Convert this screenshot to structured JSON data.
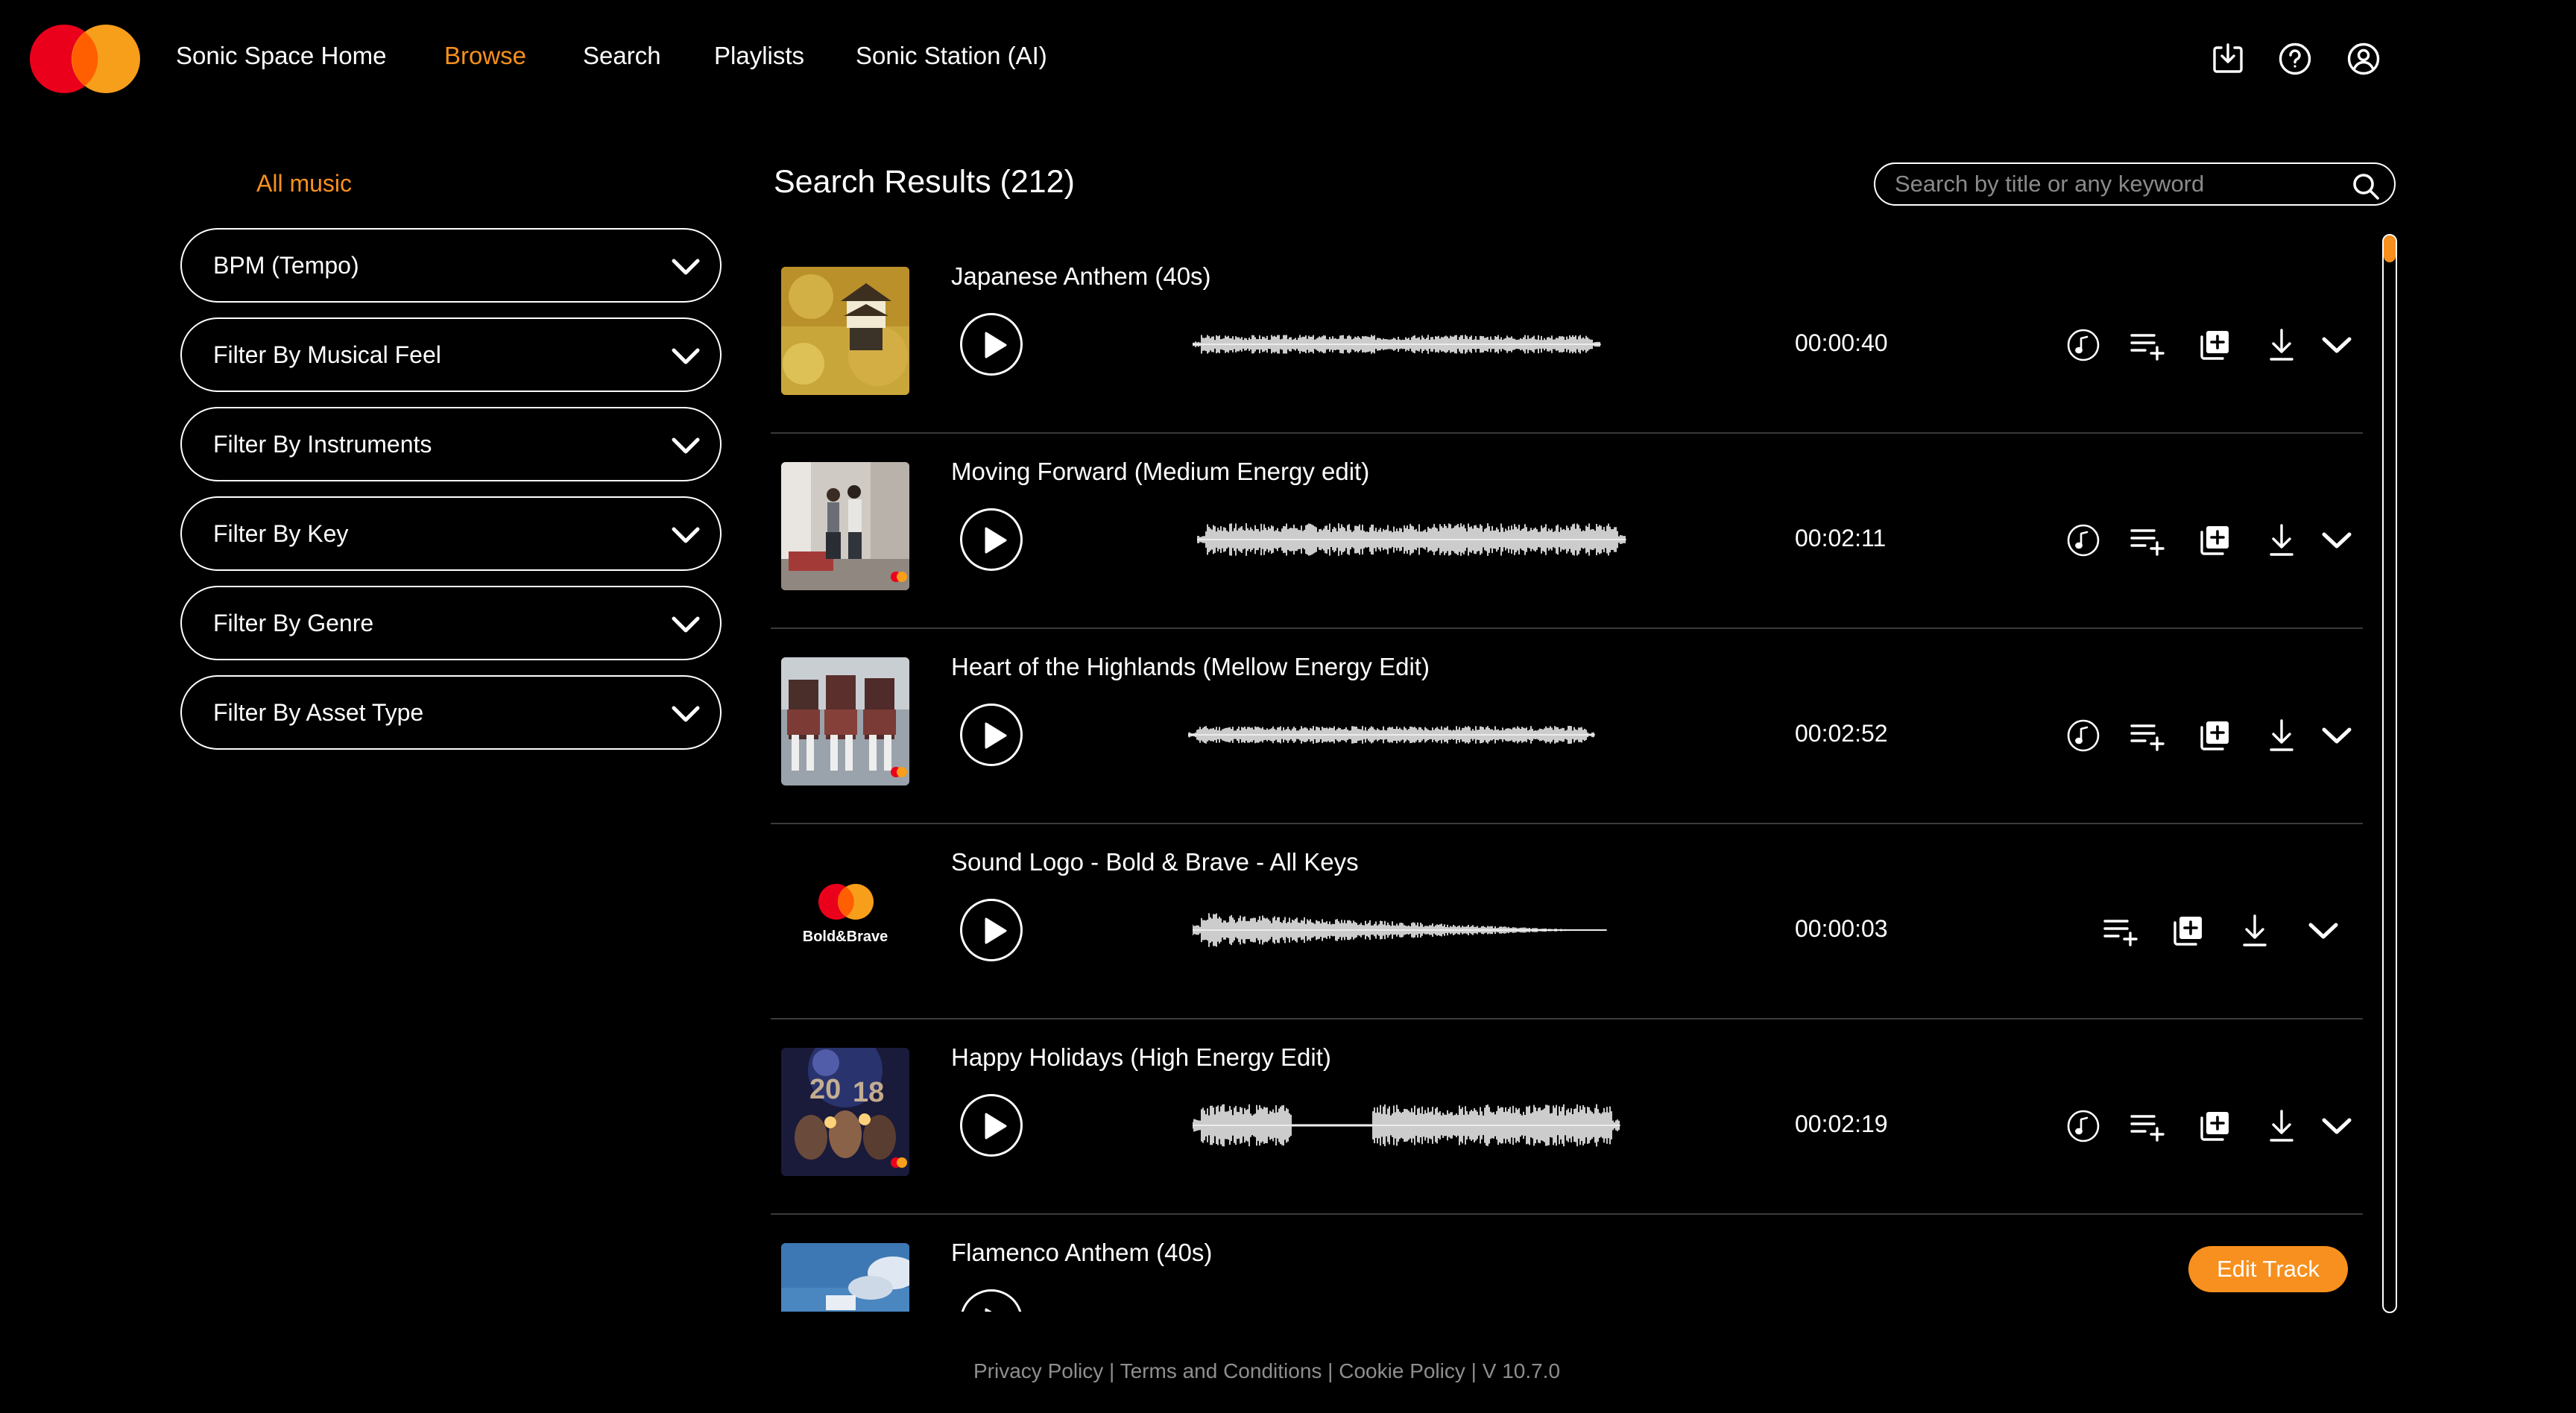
{
  "brand": {
    "logo_icon": "mastercard-logo-icon",
    "colors": {
      "red": "#eb001b",
      "orange": "#f79e1b",
      "accent": "#f7901e"
    }
  },
  "nav": {
    "home": "Sonic Space Home",
    "browse": "Browse",
    "search": "Search",
    "playlists": "Playlists",
    "station": "Sonic Station (AI)",
    "icons": [
      "download-tray-icon",
      "help-icon",
      "account-icon"
    ]
  },
  "sidebar": {
    "all_music": "All music",
    "filters": [
      {
        "label": "BPM (Tempo)"
      },
      {
        "label": "Filter By Musical Feel"
      },
      {
        "label": "Filter By Instruments"
      },
      {
        "label": "Filter By Key"
      },
      {
        "label": "Filter By Genre"
      },
      {
        "label": "Filter By Asset Type"
      }
    ]
  },
  "results": {
    "title": "Search Results (212)",
    "search_placeholder": "Search by title or any keyword",
    "tracks": [
      {
        "title": "Japanese Anthem (40s)",
        "duration": "00:00:40",
        "thumb": "castle-blossom"
      },
      {
        "title": "Moving Forward (Medium Energy edit)",
        "duration": "00:02:11",
        "thumb": "people-room"
      },
      {
        "title": "Heart of the Highlands (Mellow Energy Edit)",
        "duration": "00:02:52",
        "thumb": "bagpipers"
      },
      {
        "title": "Sound Logo - Bold & Brave - All Keys",
        "duration": "00:00:03",
        "thumb": "bold-brave-logo",
        "thumb_text": "Bold&Brave"
      },
      {
        "title": "Happy Holidays (High Energy Edit)",
        "duration": "00:02:19",
        "thumb": "party-2018"
      },
      {
        "title": "Flamenco Anthem (40s)",
        "duration": "",
        "thumb": "sky-building"
      }
    ],
    "edit_track_label": "Edit Track",
    "action_icons": [
      "music-note-icon",
      "add-to-playlist-icon",
      "add-to-collection-icon",
      "download-icon",
      "chevron-down-icon"
    ]
  },
  "footer": {
    "privacy": "Privacy Policy",
    "sep1": " | ",
    "terms": "Terms and Conditions",
    "sep2": "  | ",
    "cookie": "Cookie Policy",
    "sep3": " | ",
    "version": "V 10.7.0"
  }
}
